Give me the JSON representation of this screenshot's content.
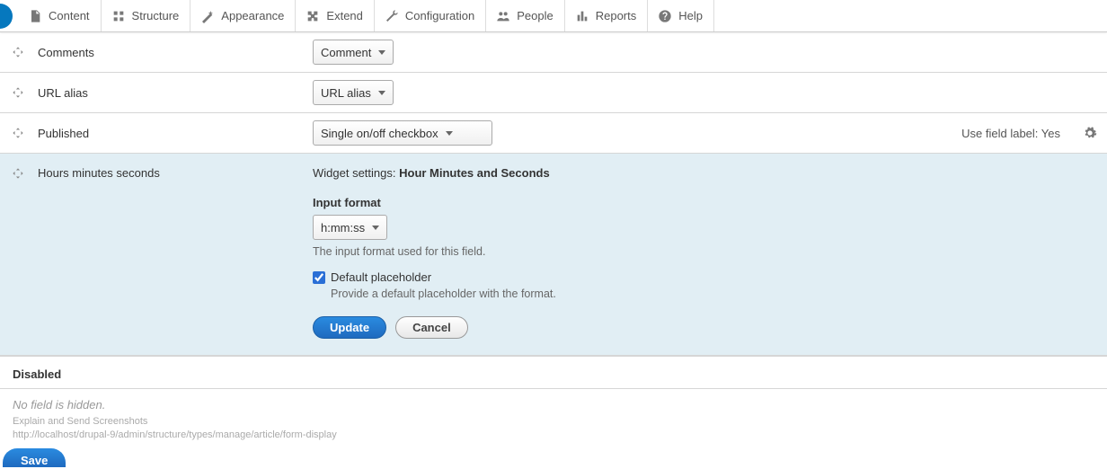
{
  "toolbar": {
    "content": "Content",
    "structure": "Structure",
    "appearance": "Appearance",
    "extend": "Extend",
    "configuration": "Configuration",
    "people": "People",
    "reports": "Reports",
    "help": "Help"
  },
  "rows": {
    "comments": {
      "name": "Comments",
      "widget": "Comment"
    },
    "url_alias": {
      "name": "URL alias",
      "widget": "URL alias"
    },
    "published": {
      "name": "Published",
      "widget": "Single on/off checkbox",
      "summary": "Use field label: Yes"
    },
    "hms": {
      "name": "Hours minutes seconds",
      "widget_settings_prefix": "Widget settings: ",
      "widget_settings_value": "Hour Minutes and Seconds",
      "input_format_label": "Input format",
      "input_format_value": "h:mm:ss",
      "input_format_help": "The input format used for this field.",
      "default_placeholder_label": "Default placeholder",
      "default_placeholder_help": "Provide a default placeholder with the format.",
      "update": "Update",
      "cancel": "Cancel"
    }
  },
  "disabled_heading": "Disabled",
  "disabled_empty": "No field is hidden.",
  "faint1": "Explain and Send Screenshots",
  "faint2": "http://localhost/drupal-9/admin/structure/types/manage/article/form-display",
  "save": "Save"
}
